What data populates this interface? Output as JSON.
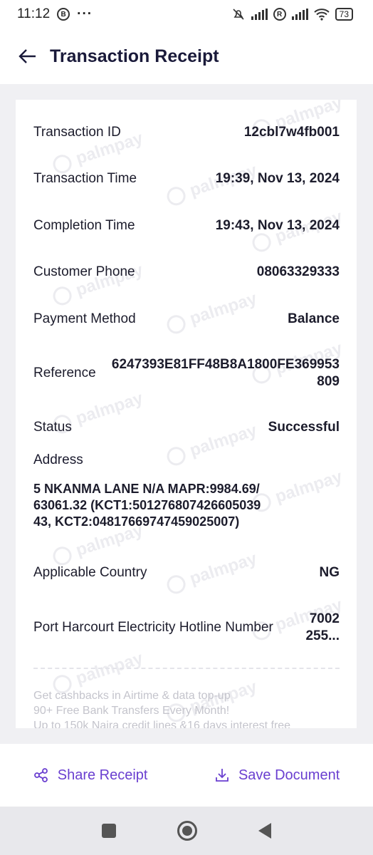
{
  "status_bar": {
    "time": "11:12",
    "left_icons": [
      "b-circle-icon",
      "more-dots-icon"
    ],
    "right_icons": [
      "mute-icon",
      "signal-icon",
      "r-circle-icon",
      "signal-icon",
      "wifi-icon"
    ],
    "badge_b": "B",
    "badge_r": "R",
    "more": "···",
    "battery": "73"
  },
  "header": {
    "title": "Transaction Receipt"
  },
  "watermark_text": "palmpay",
  "receipt": {
    "transaction_id": {
      "label": "Transaction ID",
      "value": "12cbl7w4fb001"
    },
    "transaction_time": {
      "label": "Transaction Time",
      "value": "19:39, Nov 13, 2024"
    },
    "completion_time": {
      "label": "Completion Time",
      "value": "19:43, Nov 13, 2024"
    },
    "customer_phone": {
      "label": "Customer Phone",
      "value": "08063329333"
    },
    "payment_method": {
      "label": "Payment Method",
      "value": "Balance"
    },
    "reference": {
      "label": "Reference",
      "value": "6247393E81FF48B8A1800FE369953809"
    },
    "status": {
      "label": "Status",
      "value": "Successful"
    },
    "address": {
      "label": "Address",
      "value": "5 NKANMA LANE N/A MAPR:9984.69/63061.32 (KCT1:50127680742660503943, KCT2:04817669747459025007)"
    },
    "applicable_country": {
      "label": "Applicable Country",
      "value": "NG"
    },
    "hotline": {
      "label": "Port Harcourt Electricity Hotline Number",
      "value": "7002 255..."
    }
  },
  "promo": {
    "line1": "Get cashbacks in Airtime & data top-up",
    "line2": "90+ Free Bank Transfers Every Month!",
    "line3": "Up to 150k Naira credit lines &16 days interest free"
  },
  "actions": {
    "share_label": "Share Receipt",
    "save_label": "Save Document"
  },
  "colors": {
    "accent": "#6a3fd0",
    "title": "#1a1a3a"
  }
}
